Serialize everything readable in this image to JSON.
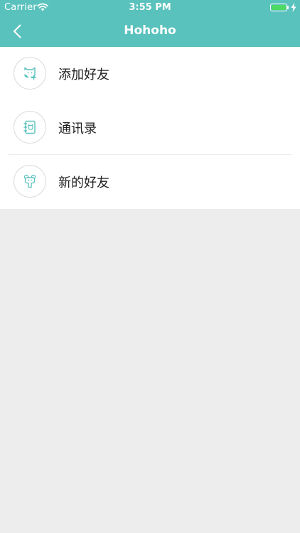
{
  "status_bar": {
    "carrier": "Carrier",
    "time": "3:55 PM",
    "battery_level_percent": 100
  },
  "nav": {
    "title": "Hohoho",
    "back_icon": "chevron-left-icon"
  },
  "menu": {
    "items": [
      {
        "label": "添加好友",
        "icon": "add-friend-icon"
      },
      {
        "label": "通讯录",
        "icon": "contacts-book-icon"
      },
      {
        "label": "新的好友",
        "icon": "new-friend-icon"
      }
    ]
  },
  "colors": {
    "header": "#5ac2bd",
    "accent": "#5ac2bd",
    "background": "#ededed",
    "battery": "#4cd964"
  }
}
